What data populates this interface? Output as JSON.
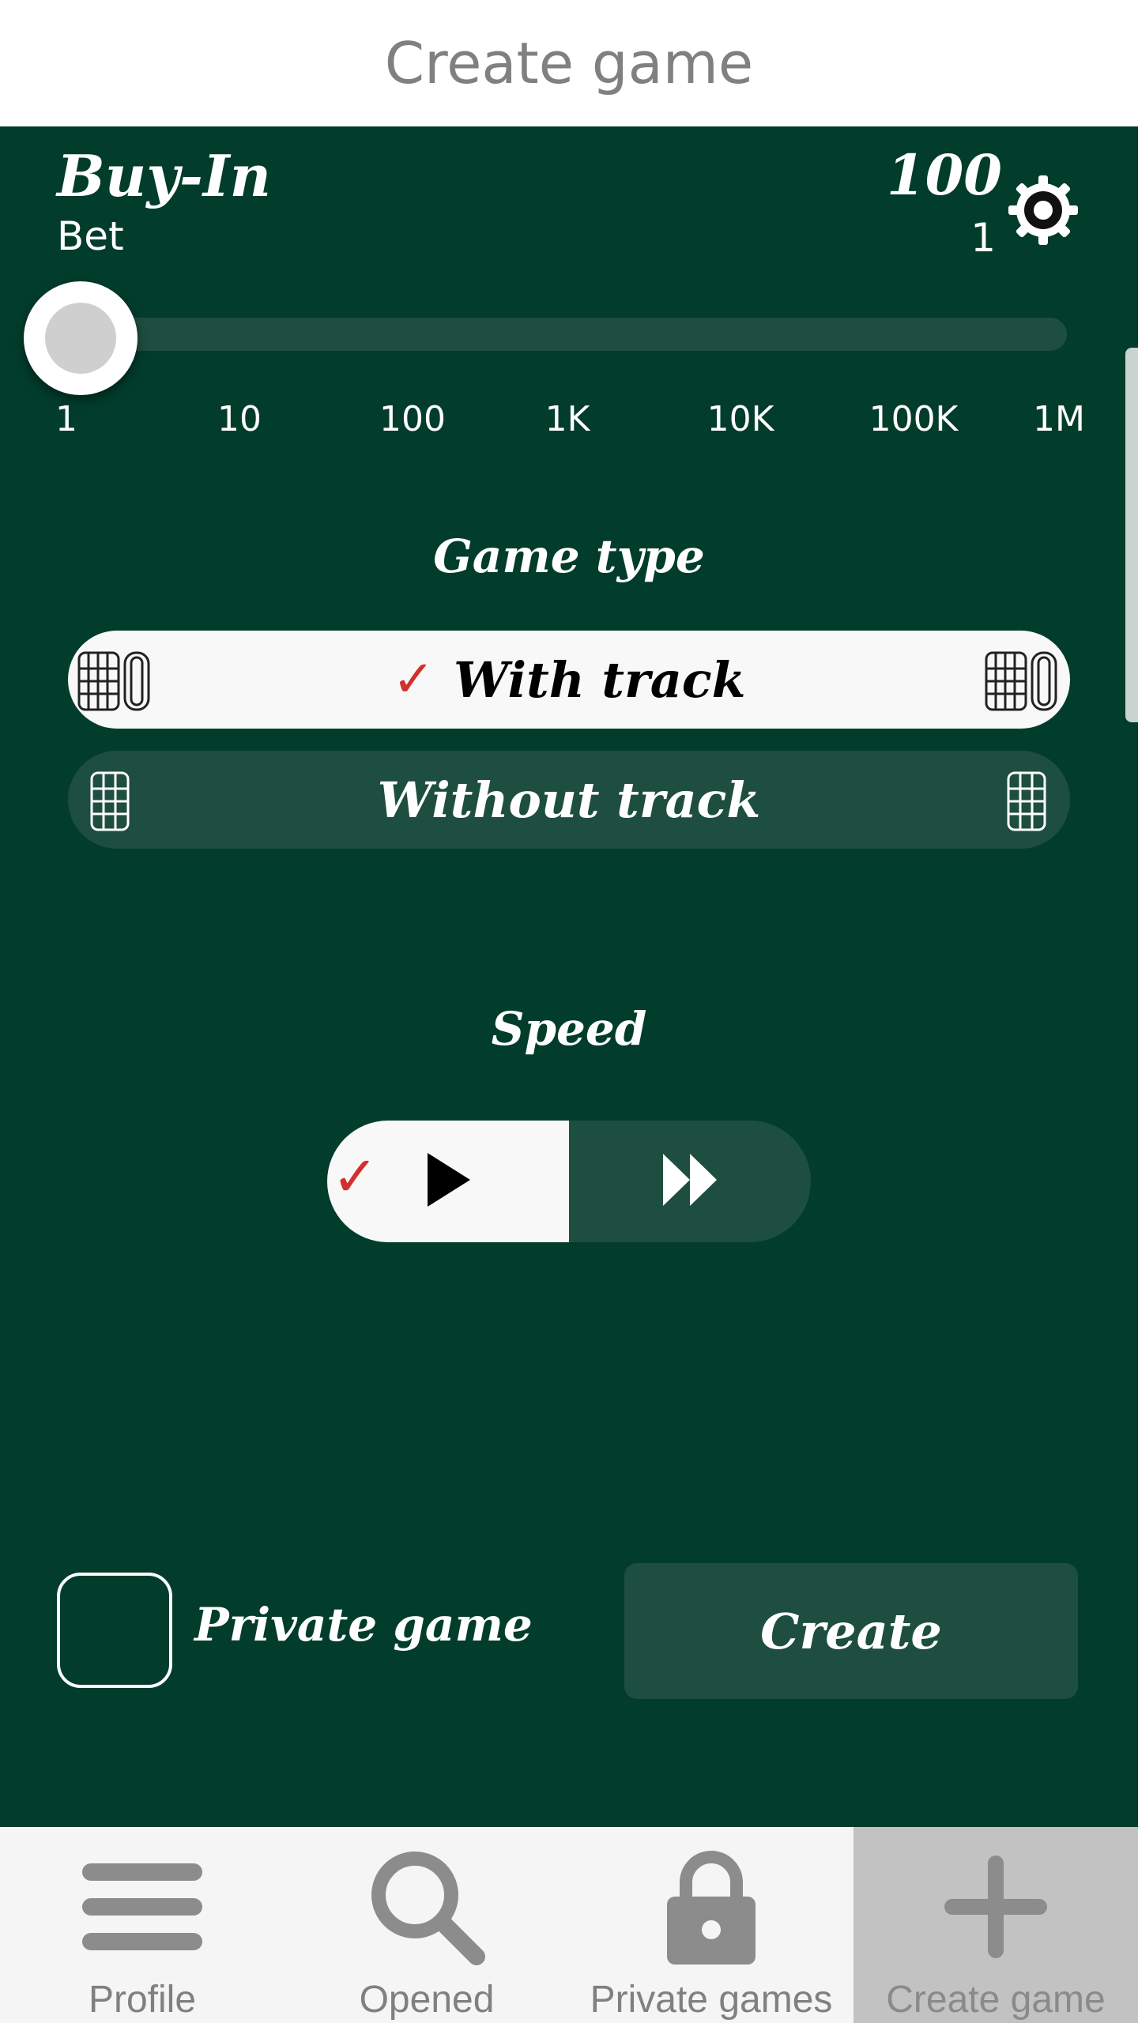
{
  "header": {
    "title": "Create game"
  },
  "buyin": {
    "label": "Buy-In",
    "bet_label": "Bet",
    "value": "100",
    "bet_value": "1",
    "slider_position_fraction": 0.0,
    "ticks": [
      "1",
      "10",
      "100",
      "1K",
      "10K",
      "100K",
      "1M"
    ]
  },
  "game_type": {
    "title": "Game type",
    "options": [
      {
        "label": "With track",
        "selected": true
      },
      {
        "label": "Without track",
        "selected": false
      }
    ],
    "check_mark": "✓"
  },
  "speed": {
    "title": "Speed",
    "options": [
      {
        "icon": "play-icon",
        "selected": true
      },
      {
        "icon": "fast-forward-icon",
        "selected": false
      }
    ],
    "check_mark": "✓"
  },
  "private_game": {
    "label": "Private game",
    "checked": false
  },
  "create_button": {
    "label": "Create"
  },
  "tabs": [
    {
      "label": "Profile",
      "icon": "menu-icon",
      "active": false
    },
    {
      "label": "Opened",
      "icon": "search-icon",
      "active": false
    },
    {
      "label": "Private games",
      "icon": "lock-icon",
      "active": false
    },
    {
      "label": "Create game",
      "icon": "plus-icon",
      "active": true
    }
  ],
  "colors": {
    "background": "#023d2c",
    "control_dark": "#1e4e3f",
    "selected_bg": "#f8f8f8",
    "check_red": "#d32f2f",
    "header_text": "#808080"
  }
}
